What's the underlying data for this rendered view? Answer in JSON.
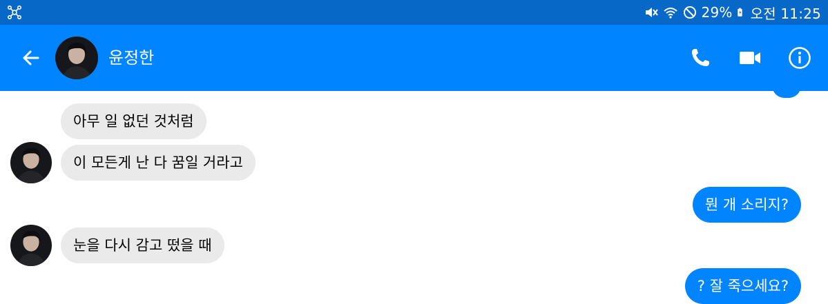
{
  "status_bar": {
    "battery": "29%",
    "time": "오전 11:25",
    "icons": [
      "cast-icon",
      "mute-icon",
      "wifi-icon",
      "no-disturb-icon",
      "battery-icon"
    ]
  },
  "header": {
    "contact_name": "윤정한",
    "icons": [
      "back-arrow-icon",
      "phone-icon",
      "video-camera-icon",
      "info-icon"
    ]
  },
  "colors": {
    "status_bar": "#0868c8",
    "app_bar": "#0084ff",
    "incoming_bubble": "#eaeaea",
    "outgoing_bubble": "#0084ff"
  },
  "messages": [
    {
      "direction": "incoming",
      "text": "아무 일 없던 것처럼"
    },
    {
      "direction": "incoming",
      "text": "이 모든게 난 다 꿈일 거라고"
    },
    {
      "direction": "outgoing",
      "text": "뭔 개 소리지?"
    },
    {
      "direction": "incoming",
      "text": "눈을 다시 감고 떴을 때"
    },
    {
      "direction": "outgoing",
      "text": "? 잘 죽으세요?"
    }
  ]
}
